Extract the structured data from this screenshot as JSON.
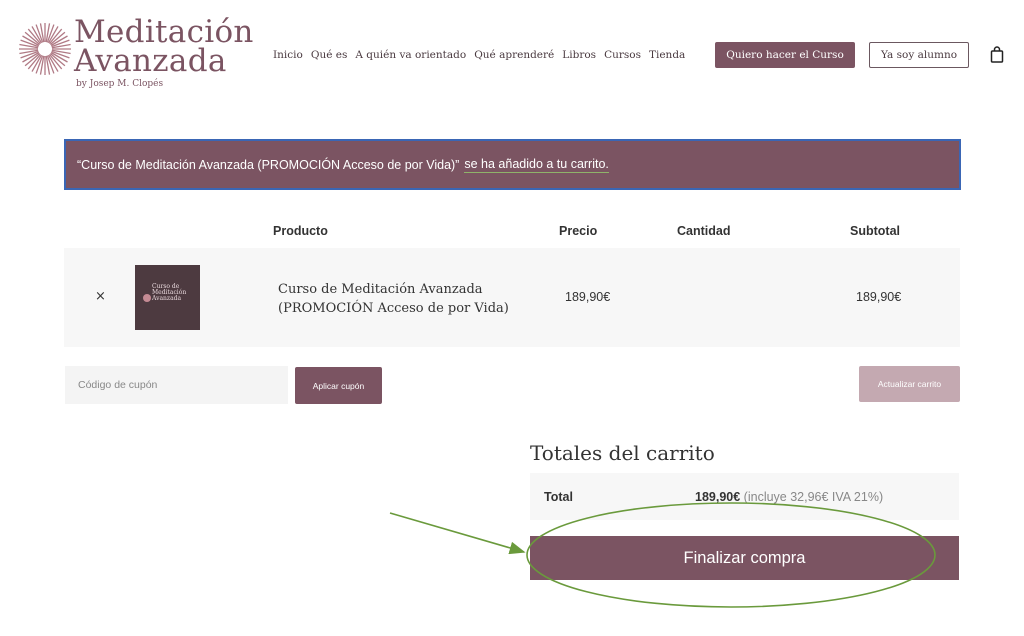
{
  "brand": {
    "title_line1": "Meditación",
    "title_line2": "Avanzada",
    "byline": "by Josep M. Clopés",
    "color": "#7b5462"
  },
  "nav": {
    "items": [
      "Inicio",
      "Qué es",
      "A quién va orientado",
      "Qué aprenderé",
      "Libros",
      "Cursos",
      "Tienda"
    ],
    "cta_primary": "Quiero hacer el Curso",
    "cta_secondary": "Ya soy alumno",
    "cart_icon": "shopping-bag-icon"
  },
  "notice": {
    "text": "“Curso de Meditación Avanzada (PROMOCIÓN Acceso de por Vida)”",
    "link": "se ha añadido a tu carrito.",
    "border_color": "#3a66b5"
  },
  "cart": {
    "headers": {
      "product": "Producto",
      "price": "Precio",
      "quantity": "Cantidad",
      "subtotal": "Subtotal"
    },
    "items": [
      {
        "remove": "×",
        "thumb_text": "Curso de\nMeditación\nAvanzada",
        "name_line1": "Curso de Meditación Avanzada",
        "name_line2": "(PROMOCIÓN Acceso de por Vida)",
        "price": "189,90€",
        "subtotal": "189,90€"
      }
    ],
    "coupon_placeholder": "Código de cupón",
    "apply_label": "Aplicar cupón",
    "update_label": "Actualizar carrito"
  },
  "totals": {
    "title": "Totales del carrito",
    "total_label": "Total",
    "total_amount": "189,90€",
    "total_tax": "(incluye 32,96€ IVA 21%)",
    "checkout_label": "Finalizar compra"
  },
  "annotation": {
    "color": "#6a9a3c"
  }
}
